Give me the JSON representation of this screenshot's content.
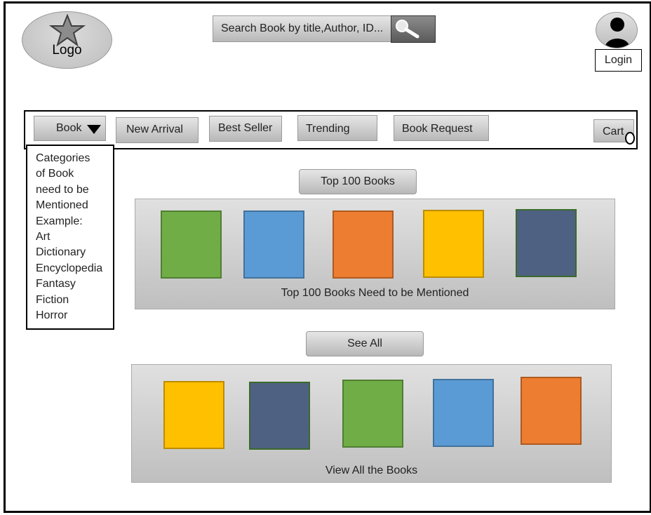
{
  "header": {
    "logo_text": "Logo",
    "search_placeholder": "Search Book by title,Author, ID...",
    "login_label": "Login"
  },
  "nav": {
    "book": "Book",
    "new_arrival": "New Arrival",
    "best_seller": "Best Seller",
    "trending": "Trending",
    "book_request": "Book Request",
    "cart": "Cart"
  },
  "dropdown": {
    "lines": [
      "Categories",
      "of Book",
      "need to be",
      "Mentioned",
      "Example:",
      "Art",
      "Dictionary",
      "Encyclopedia",
      "Fantasy",
      "Fiction",
      "Horror"
    ]
  },
  "top100": {
    "button_label": "Top 100 Books",
    "caption": "Top 100 Books Need to be Mentioned",
    "covers": [
      "#70ad47",
      "#5b9bd5",
      "#ed7d31",
      "#ffc000",
      "#4f6182"
    ]
  },
  "all_books": {
    "button_label": "See All",
    "caption": "View All the Books",
    "covers": [
      "#ffc000",
      "#4f6182",
      "#70ad47",
      "#5b9bd5",
      "#ed7d31"
    ]
  },
  "colors": {
    "green": "#70ad47",
    "blue": "#5b9bd5",
    "orange": "#ed7d31",
    "yellow": "#ffc000",
    "slate": "#4f6182"
  }
}
